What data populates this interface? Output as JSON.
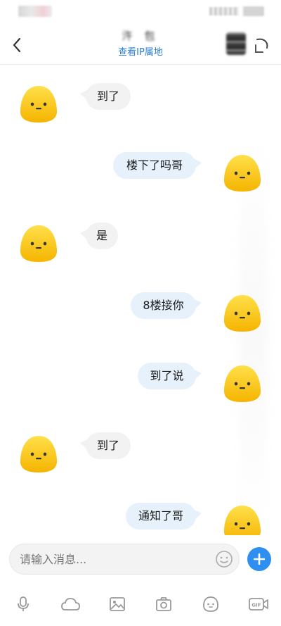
{
  "header": {
    "contact_name": "汻 包",
    "ip_link": "查看IP属地"
  },
  "messages": [
    {
      "side": "received",
      "text": "到了"
    },
    {
      "side": "sent",
      "text": "楼下了吗哥"
    },
    {
      "side": "received",
      "text": "是"
    },
    {
      "side": "sent",
      "text": "8楼接你"
    },
    {
      "side": "sent",
      "text": "到了说"
    },
    {
      "side": "received",
      "text": "到了"
    },
    {
      "side": "sent",
      "text": "通知了哥"
    }
  ],
  "input": {
    "placeholder": "请输入消息..."
  },
  "toolbar": {
    "icons": [
      "microphone-icon",
      "cloud-icon",
      "image-icon",
      "camera-icon",
      "sticker-icon",
      "gif-icon"
    ],
    "gif_label": "GIF"
  },
  "colors": {
    "accent": "#2f8ff0",
    "link": "#2b7fd6",
    "sent_bubble": "#e6f1fb",
    "received_bubble": "#f2f2f2",
    "avatar_yellow": "#f9c81e"
  }
}
